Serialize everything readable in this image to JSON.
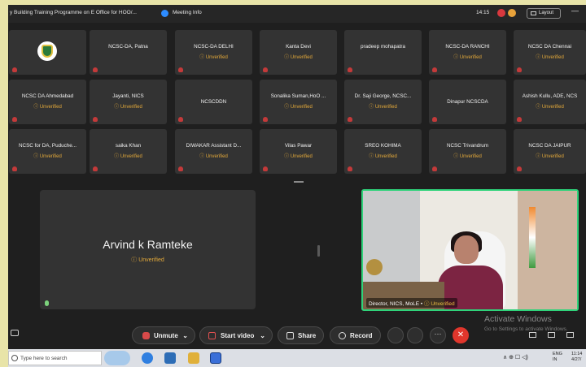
{
  "titlebar": {
    "title": "y Building Training Programme on E Office for HOO/...",
    "meeting_info": "Meeting Info",
    "time": "14:15",
    "layout_label": "Layout",
    "minimize": "—"
  },
  "participants": [
    {
      "name": "",
      "status": ""
    },
    {
      "name": "NCSC-DA, Patna",
      "status": ""
    },
    {
      "name": "NCSC-DA DELHI",
      "status": "ⓘ Unverified"
    },
    {
      "name": "Kanta Devi",
      "status": "ⓘ Unverified"
    },
    {
      "name": "pradeep mohapatra",
      "status": ""
    },
    {
      "name": "NCSC-DA RANCHI",
      "status": "ⓘ Unverified"
    },
    {
      "name": "NCSC DA Chennai",
      "status": "ⓘ Unverified"
    },
    {
      "name": "NCSC DA Ahmedabad",
      "status": "ⓘ Unverified"
    },
    {
      "name": "Jayanti, NICS",
      "status": "ⓘ Unverified"
    },
    {
      "name": "NCSCDDN",
      "status": ""
    },
    {
      "name": "Sonalika Suman,HoO ...",
      "status": "ⓘ Unverified"
    },
    {
      "name": "Dr. Saji George, NCSC...",
      "status": "ⓘ Unverified"
    },
    {
      "name": "Dinapur NCSCDA",
      "status": ""
    },
    {
      "name": "Ashish Kullu, ADE, NCS",
      "status": "ⓘ Unverified"
    },
    {
      "name": "NCSC for DA, Puduche...",
      "status": "ⓘ Unverified"
    },
    {
      "name": "saika Khan",
      "status": "ⓘ Unverified"
    },
    {
      "name": "DIWAKAR   Assistant D...",
      "status": "ⓘ Unverified"
    },
    {
      "name": "Vilas Pawar",
      "status": "ⓘ Unverified"
    },
    {
      "name": "SREO KOHIMA",
      "status": "ⓘ Unverified"
    },
    {
      "name": "NCSC Trivandrum",
      "status": "ⓘ Unverified"
    },
    {
      "name": "NCSC DA JAIPUR",
      "status": "ⓘ Unverified"
    }
  ],
  "main_tile": {
    "name": "Arvind k Ramteke",
    "status": "ⓘ Unverified"
  },
  "video_tile": {
    "caption_name": "Director, NICS, MoLE •",
    "caption_status": "ⓘ Unverified"
  },
  "watermark": {
    "title": "Activate Windows",
    "subtitle": "Go to Settings to activate Windows."
  },
  "toolbar": {
    "unmute_label": "Unmute",
    "start_video_label": "Start video",
    "share_label": "Share",
    "record_label": "Record",
    "more_label": "···",
    "end_label": "✕"
  },
  "taskbar": {
    "search_placeholder": "Type here to search",
    "tray_icons": "∧  ⊕  ☐  ◁)",
    "lang_line1": "ENG",
    "lang_line2": "IN",
    "clock_line1": "11:14",
    "clock_line2": "4/27/"
  },
  "colors": {
    "accent_green": "#2fd37a",
    "unverified": "#e3a93a",
    "end_red": "#e0362c"
  }
}
